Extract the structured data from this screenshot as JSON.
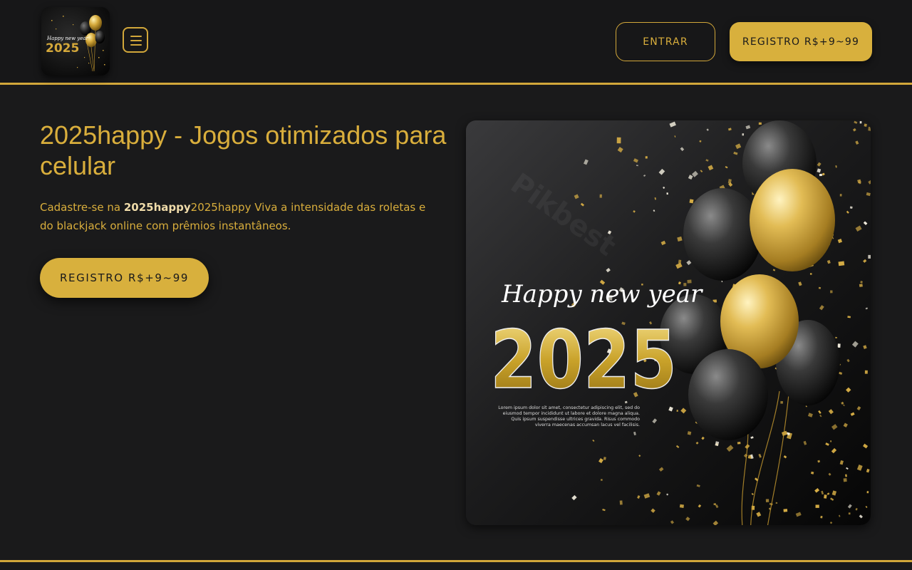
{
  "header": {
    "logo": {
      "line1": "Happy new year",
      "line2": "2025"
    },
    "login_label": "ENTRAR",
    "register_label": "REGISTRO R$+9~99"
  },
  "hero": {
    "title": "2025happy - Jogos otimizados para celular",
    "desc_before": "Cadastre-se na ",
    "desc_brand": "2025happy",
    "desc_after": "2025happy Viva a intensidade das roletas e do blackjack online com prêmios instantâneos.",
    "cta_label": "REGISTRO R$+9~99"
  },
  "banner": {
    "headline": "Happy new year",
    "year": "2025",
    "body_lines": [
      "Lorem ipsum dolor sit amet, consectetur adipiscing elit, sed do",
      "eiusmod tempor incididunt ut labore et dolore magna aliqua.",
      "Quis ipsum suspendisse ultrices gravida. Risus commodo",
      "viverra maecenas accumsan lacus vel facilisis."
    ],
    "watermark": "Pikbest"
  },
  "colors": {
    "accent": "#d8b03d",
    "background": "#1a1a1b",
    "header_bg": "#171718"
  }
}
